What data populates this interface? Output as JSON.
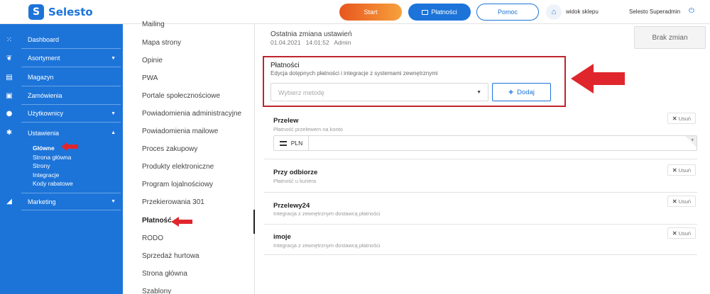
{
  "header": {
    "logo_text": "Selesto",
    "logo_mark": "S",
    "start_label": "Start",
    "payments_label": "Płatności",
    "help_label": "Pomoc",
    "shop_view_label": "widok sklepu",
    "admin_name": "Selesto Superadmin",
    "icons": [
      "home-icon",
      "power-icon",
      "card-icon"
    ]
  },
  "sidebar": {
    "items": [
      {
        "label": "Dashboard",
        "icon": "grid-icon",
        "has_caret": false
      },
      {
        "label": "Asortyment",
        "icon": "tag-icon",
        "has_caret": true
      },
      {
        "label": "Magazyn",
        "icon": "warehouse-icon",
        "has_caret": false
      },
      {
        "label": "Zamówienia",
        "icon": "bag-icon",
        "has_caret": false
      },
      {
        "label": "Użytkownicy",
        "icon": "user-icon",
        "has_caret": true
      },
      {
        "label": "Ustawienia",
        "icon": "gear-icon",
        "has_caret": true,
        "expanded": true
      },
      {
        "label": "Marketing",
        "icon": "megaphone-icon",
        "has_caret": true
      }
    ],
    "submenu": [
      "Główne",
      "Strona główna",
      "Strony",
      "Integracje",
      "Kody rabatowe"
    ],
    "caret_down": "▼",
    "caret_up": "▲"
  },
  "settings_list": {
    "items": [
      "Mailing",
      "Mapa strony",
      "Opinie",
      "PWA",
      "Portale społecznościowe",
      "Powiadomienia administracyjne",
      "Powiadomienia mailowe",
      "Proces zakupowy",
      "Produkty elektroniczne",
      "Program lojalnościowy",
      "Przekierowania 301",
      "Płatność",
      "RODO",
      "Sprzedaż hurtowa",
      "Strona główna",
      "Szablony"
    ],
    "active": "Płatność"
  },
  "main": {
    "last_change_title": "Ostatnia zmiana ustawień",
    "last_change_meta": "01.04.2021   14:01:52   Admin",
    "no_changes_label": "Brak zmian",
    "payments_title": "Płatności",
    "payments_subtitle": "Edycja dotępnych płatności i integracje z systemami zewnętrznymi",
    "select_placeholder": "Wybierz metodę",
    "add_label": "Dodaj",
    "remove_label": "Usuń",
    "methods": [
      {
        "name": "Przelew",
        "desc": "Płatność przelewem na konto",
        "currency": "PLN"
      },
      {
        "name": "Przy odbiorze",
        "desc": "Płatność u kuriera"
      },
      {
        "name": "Przelewy24",
        "desc": "Integracja z zewnętrznym dostawcą płatności"
      },
      {
        "name": "imoje",
        "desc": "Integracja z zewnętrznym dostawcą płatności"
      }
    ],
    "required_mark": "*"
  },
  "colors": {
    "brand": "#1c74d9",
    "highlight": "#c0242b",
    "start_gradient": [
      "#e8561f",
      "#f7a13c"
    ]
  }
}
